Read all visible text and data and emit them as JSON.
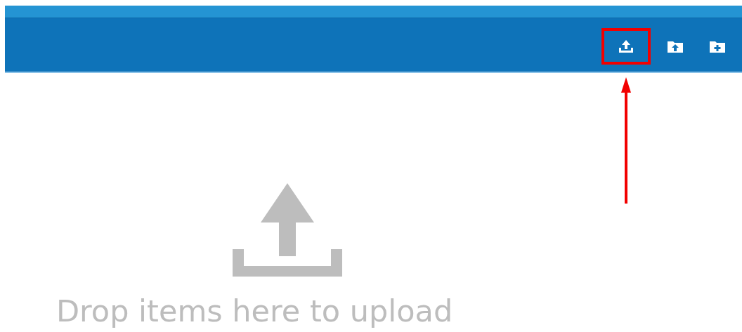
{
  "toolbar": {
    "buttons": [
      {
        "kind": "upload",
        "highlighted": true
      },
      {
        "kind": "folder-upload",
        "highlighted": false
      },
      {
        "kind": "folder-add",
        "highlighted": false
      }
    ]
  },
  "dropzone": {
    "message": "Drop items here to upload"
  },
  "annotation": {
    "arrow": true
  }
}
